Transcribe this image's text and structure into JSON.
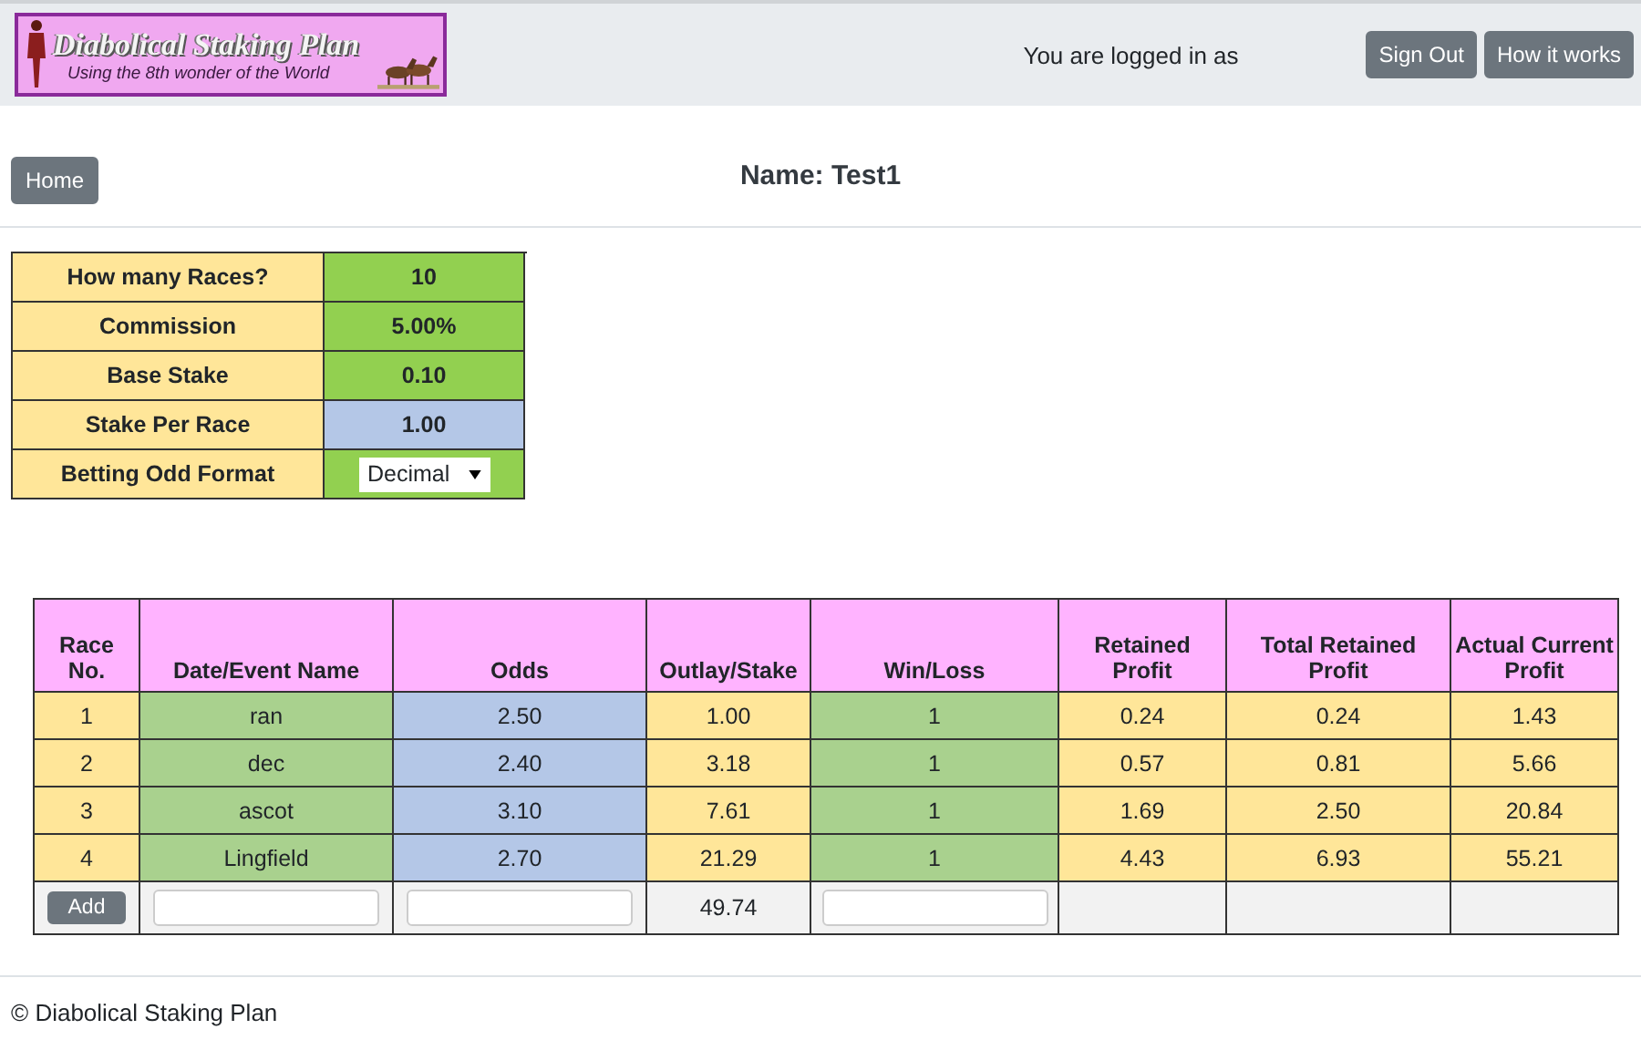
{
  "header": {
    "logo_title": "Diabolical Staking Plan",
    "logo_subtitle": "Using the 8th wonder of the World",
    "login_text": "You are logged in as",
    "buttons": [
      "Sign Out",
      "How it works"
    ]
  },
  "home_button": "Home",
  "page_title": "Name: Test1",
  "settings": [
    {
      "label": "How many Races?",
      "kind": "value",
      "value": "10",
      "color": "#92d050"
    },
    {
      "label": "Commission",
      "kind": "value",
      "value": "5.00%",
      "color": "#92d050"
    },
    {
      "label": "Base Stake",
      "kind": "value",
      "value": "0.10",
      "color": "#92d050"
    },
    {
      "label": "Stake Per Race",
      "kind": "value",
      "value": "1.00",
      "color": "#b4c7e7"
    },
    {
      "label": "Betting Odd Format",
      "kind": "select",
      "value": "Decimal",
      "color": "#92d050"
    }
  ],
  "table": {
    "columns": [
      {
        "label": "Race No.",
        "color": "#ffe699"
      },
      {
        "label": "Date/Event Name",
        "color": "#a9d18e"
      },
      {
        "label": "Odds",
        "color": "#b4c7e7"
      },
      {
        "label": "Outlay/Stake",
        "color": "#ffe699"
      },
      {
        "label": "Win/Loss",
        "color": "#a9d18e"
      },
      {
        "label": "Retained Profit",
        "color": "#ffe699"
      },
      {
        "label": "Total Retained Profit",
        "color": "#ffe699"
      },
      {
        "label": "Actual Current Profit",
        "color": "#ffe699"
      }
    ],
    "rows": [
      [
        "1",
        "ran",
        "2.50",
        "1.00",
        "1",
        "0.24",
        "0.24",
        "1.43"
      ],
      [
        "2",
        "dec",
        "2.40",
        "3.18",
        "1",
        "0.57",
        "0.81",
        "5.66"
      ],
      [
        "3",
        "ascot",
        "3.10",
        "7.61",
        "1",
        "1.69",
        "2.50",
        "20.84"
      ],
      [
        "4",
        "Lingfield",
        "2.70",
        "21.29",
        "1",
        "4.43",
        "6.93",
        "55.21"
      ]
    ],
    "entry_row": {
      "add_button": "Add",
      "total": "49.74"
    }
  },
  "footer": "© Diabolical Staking Plan"
}
